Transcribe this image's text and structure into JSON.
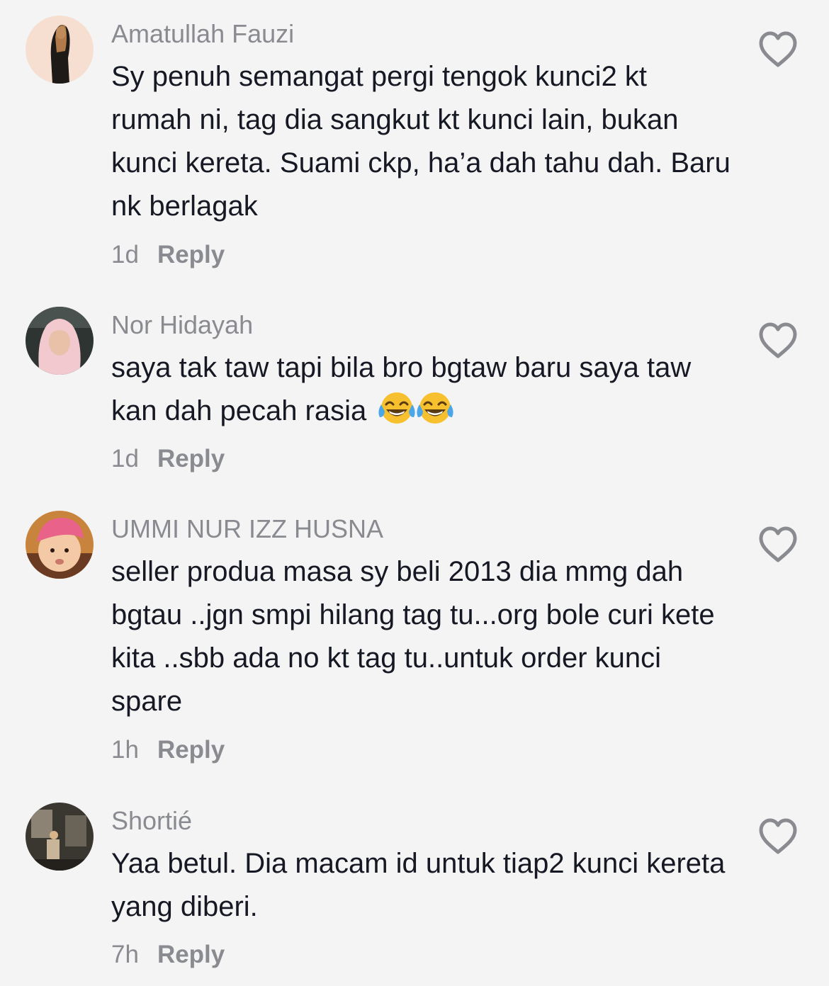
{
  "comments": [
    {
      "username": "Amatullah Fauzi",
      "text": "Sy penuh semangat pergi tengok kunci2 kt rumah ni, tag dia sangkut kt kunci lain, bukan kunci kereta. Suami ckp, ha’a dah tahu dah. Baru nk berlagak",
      "time": "1d",
      "reply_label": "Reply",
      "avatar_icon": "avatar-hijab-silhouette"
    },
    {
      "username": "Nor Hidayah",
      "text": "saya tak taw tapi bila bro bgtaw baru saya taw kan dah pecah rasia",
      "emoji": [
        "face-with-tears-of-joy",
        "face-with-tears-of-joy"
      ],
      "time": "1d",
      "reply_label": "Reply",
      "avatar_icon": "avatar-woman-pink-hijab"
    },
    {
      "username": "UMMI NUR IZZ HUSNA",
      "text": "seller produa masa sy beli 2013 dia mmg dah bgtau ..jgn smpi hilang tag tu...org bole curi kete kita ..sbb ada no kt tag tu..untuk order kunci spare",
      "time": "1h",
      "reply_label": "Reply",
      "avatar_icon": "avatar-baby-pink-hat"
    },
    {
      "username": "Shortié",
      "text": "Yaa betul. Dia macam id untuk tiap2 kunci kereta yang diberi.",
      "time": "7h",
      "reply_label": "Reply",
      "avatar_icon": "avatar-room-photo"
    }
  ],
  "like_icon": "heart-outline-icon",
  "colors": {
    "background": "#f4f4f4",
    "username": "#8a8b91",
    "text": "#161823",
    "meta": "#8a8b91",
    "icon": "#8a8b91"
  }
}
